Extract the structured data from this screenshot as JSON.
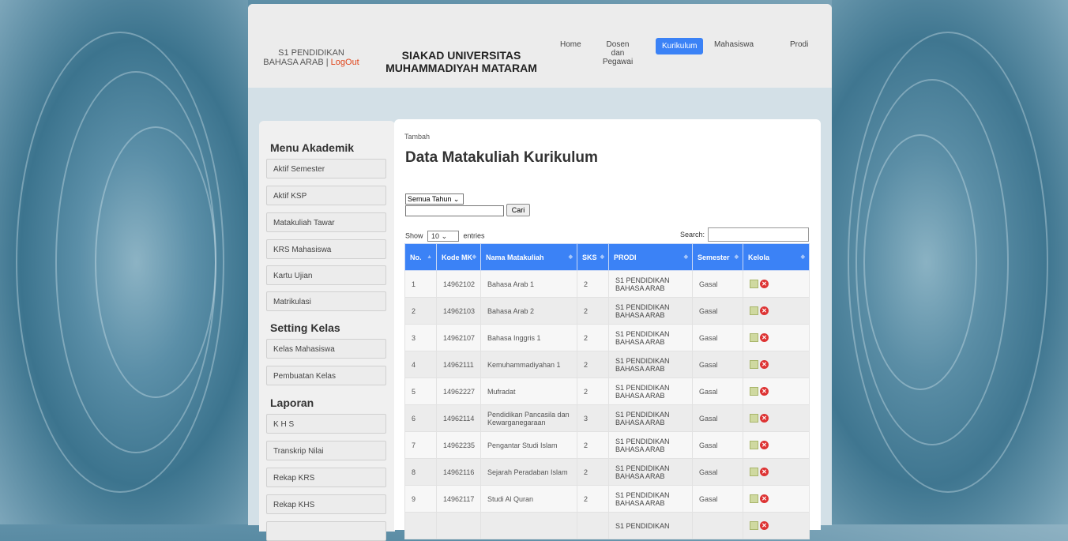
{
  "header": {
    "dept": "S1 PENDIDIKAN BAHASA ARAB",
    "separator": " | ",
    "logout": "LogOut",
    "brand": "SIAKAD UNIVERSITAS MUHAMMADIYAH MATARAM",
    "nav": [
      "Home",
      "Dosen dan Pegawai",
      "Kurikulum",
      "Mahasiswa",
      "Prodi"
    ],
    "active_nav": "Kurikulum"
  },
  "sidebar": {
    "menu_akademik_title": "Menu Akademik",
    "menu_akademik": [
      "Aktif Semester",
      "Aktif KSP",
      "Matakuliah Tawar",
      "KRS Mahasiswa",
      "Kartu Ujian",
      "Matrikulasi"
    ],
    "setting_kelas_title": "Setting Kelas",
    "setting_kelas": [
      "Kelas Mahasiswa",
      "Pembuatan Kelas"
    ],
    "laporan_title": "Laporan",
    "laporan": [
      "K H S",
      "Transkrip Nilai",
      "Rekap KRS",
      "Rekap KHS"
    ]
  },
  "main": {
    "tambah": "Tambah",
    "title": "Data Matakuliah Kurikulum",
    "year_filter": "Semua Tahun",
    "cari": "Cari",
    "show": "Show",
    "entries_value": "10",
    "entries": "entries",
    "search_label": "Search:",
    "columns": [
      "No.",
      "Kode MK",
      "Nama Matakuliah",
      "SKS",
      "PRODI",
      "Semester",
      "Kelola"
    ],
    "rows": [
      [
        "1",
        "14962102",
        "Bahasa Arab 1",
        "2",
        "S1 PENDIDIKAN BAHASA ARAB",
        "Gasal"
      ],
      [
        "2",
        "14962103",
        "Bahasa Arab 2",
        "2",
        "S1 PENDIDIKAN BAHASA ARAB",
        "Gasal"
      ],
      [
        "3",
        "14962107",
        "Bahasa Inggris 1",
        "2",
        "S1 PENDIDIKAN BAHASA ARAB",
        "Gasal"
      ],
      [
        "4",
        "14962111",
        "Kemuhammadiyahan 1",
        "2",
        "S1 PENDIDIKAN BAHASA ARAB",
        "Gasal"
      ],
      [
        "5",
        "14962227",
        "Mufradat",
        "2",
        "S1 PENDIDIKAN BAHASA ARAB",
        "Gasal"
      ],
      [
        "6",
        "14962114",
        "Pendidikan Pancasila dan Kewarganegaraan",
        "3",
        "S1 PENDIDIKAN BAHASA ARAB",
        "Gasal"
      ],
      [
        "7",
        "14962235",
        "Pengantar Studi Islam",
        "2",
        "S1 PENDIDIKAN BAHASA ARAB",
        "Gasal"
      ],
      [
        "8",
        "14962116",
        "Sejarah Peradaban Islam",
        "2",
        "S1 PENDIDIKAN BAHASA ARAB",
        "Gasal"
      ],
      [
        "9",
        "14962117",
        "Studi Al Quran",
        "2",
        "S1 PENDIDIKAN BAHASA ARAB",
        "Gasal"
      ],
      [
        "",
        "",
        "",
        "",
        "S1 PENDIDIKAN",
        ""
      ]
    ]
  },
  "colors": {
    "accent": "#3b82f6",
    "logout": "#e0451b",
    "delete": "#dd3333"
  }
}
